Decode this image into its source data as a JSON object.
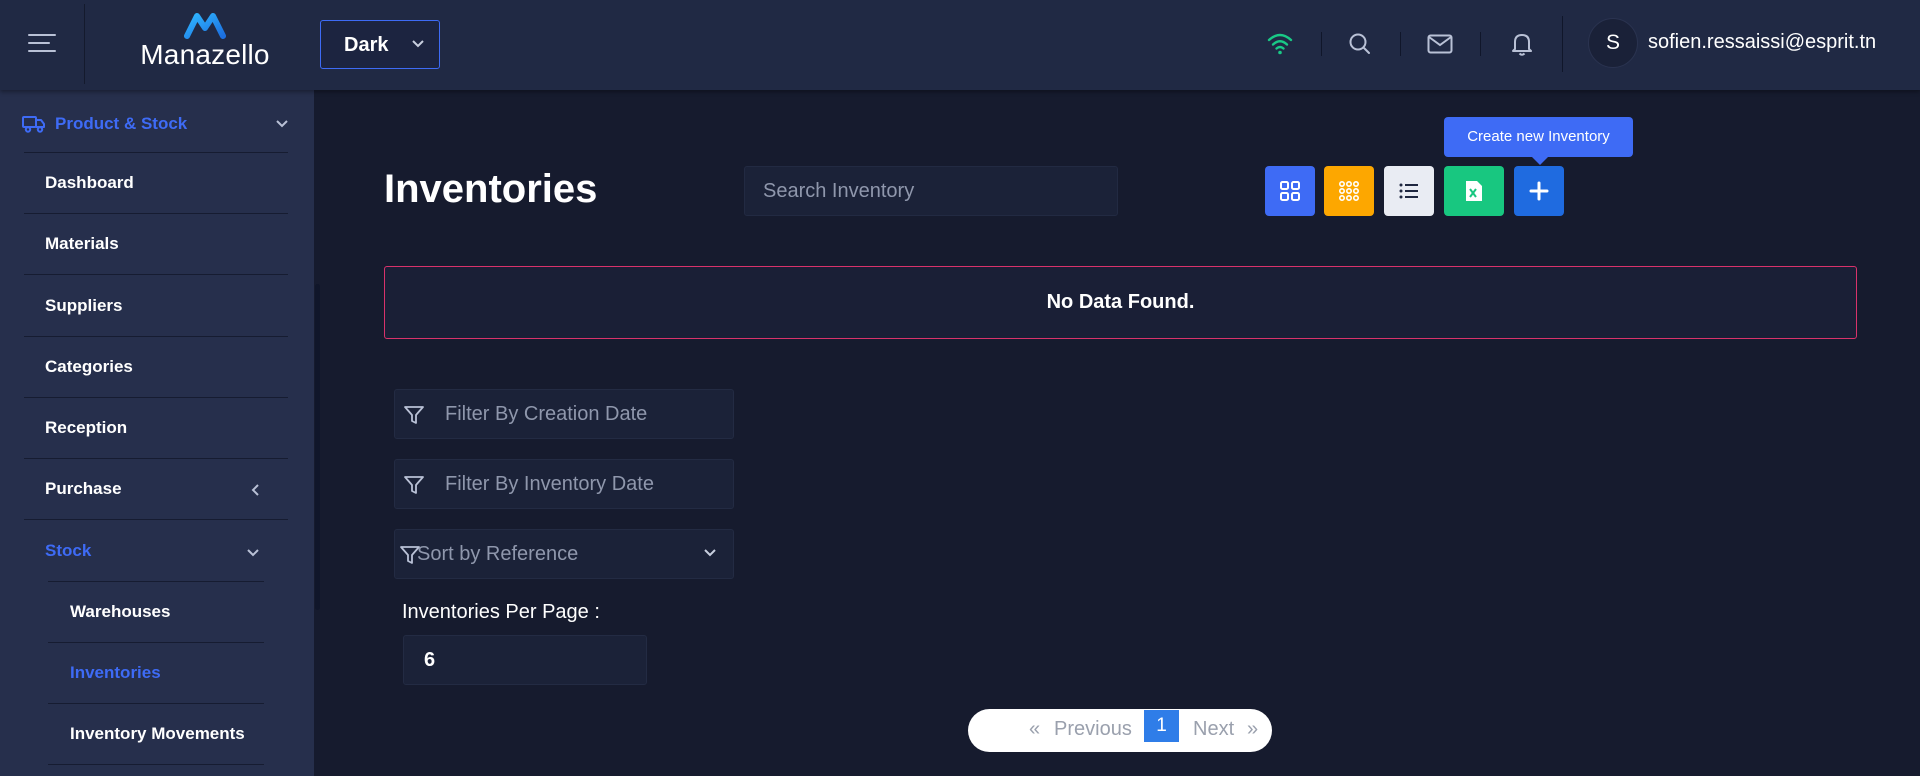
{
  "header": {
    "logo_text": "Manazello",
    "theme_select_value": "Dark",
    "user_initial": "S",
    "user_email": "sofien.ressaissi@esprit.tn",
    "colors": {
      "header_bg": "#202944",
      "wifi": "#19c986",
      "accent": "#3e6bf5"
    },
    "icons": [
      "menu-icon",
      "wifi-icon",
      "search-icon",
      "mail-icon",
      "bell-icon"
    ]
  },
  "sidebar": {
    "section": {
      "label": "Product & Stock",
      "icon": "truck-icon"
    },
    "items": [
      {
        "label": "Dashboard"
      },
      {
        "label": "Materials"
      },
      {
        "label": "Suppliers"
      },
      {
        "label": "Categories"
      },
      {
        "label": "Reception"
      },
      {
        "label": "Purchase"
      },
      {
        "label": "Stock"
      }
    ],
    "subitems": [
      {
        "label": "Warehouses"
      },
      {
        "label": "Inventories"
      },
      {
        "label": "Inventory Movements"
      }
    ]
  },
  "main": {
    "title": "Inventories",
    "search_placeholder": "Search Inventory",
    "tooltip": "Create new Inventory",
    "toolbar_buttons": [
      {
        "name": "grid-view",
        "color": "#3e6bf5"
      },
      {
        "name": "apps-view",
        "color": "#fda700"
      },
      {
        "name": "list-view",
        "color": "#e9ecf3"
      },
      {
        "name": "export-excel",
        "color": "#18c780"
      },
      {
        "name": "create-new",
        "color": "#1f6be0"
      }
    ],
    "empty_message": "No Data Found.",
    "filter_creation_placeholder": "Filter By Creation Date",
    "filter_inventory_placeholder": "Filter By Inventory Date",
    "sort_value": "Sort by Reference",
    "per_page_label": "Inventories Per Page :",
    "per_page_value": "6",
    "pagination": {
      "first": "«",
      "previous": "Previous",
      "current": "1",
      "next": "Next",
      "last": "»"
    }
  }
}
